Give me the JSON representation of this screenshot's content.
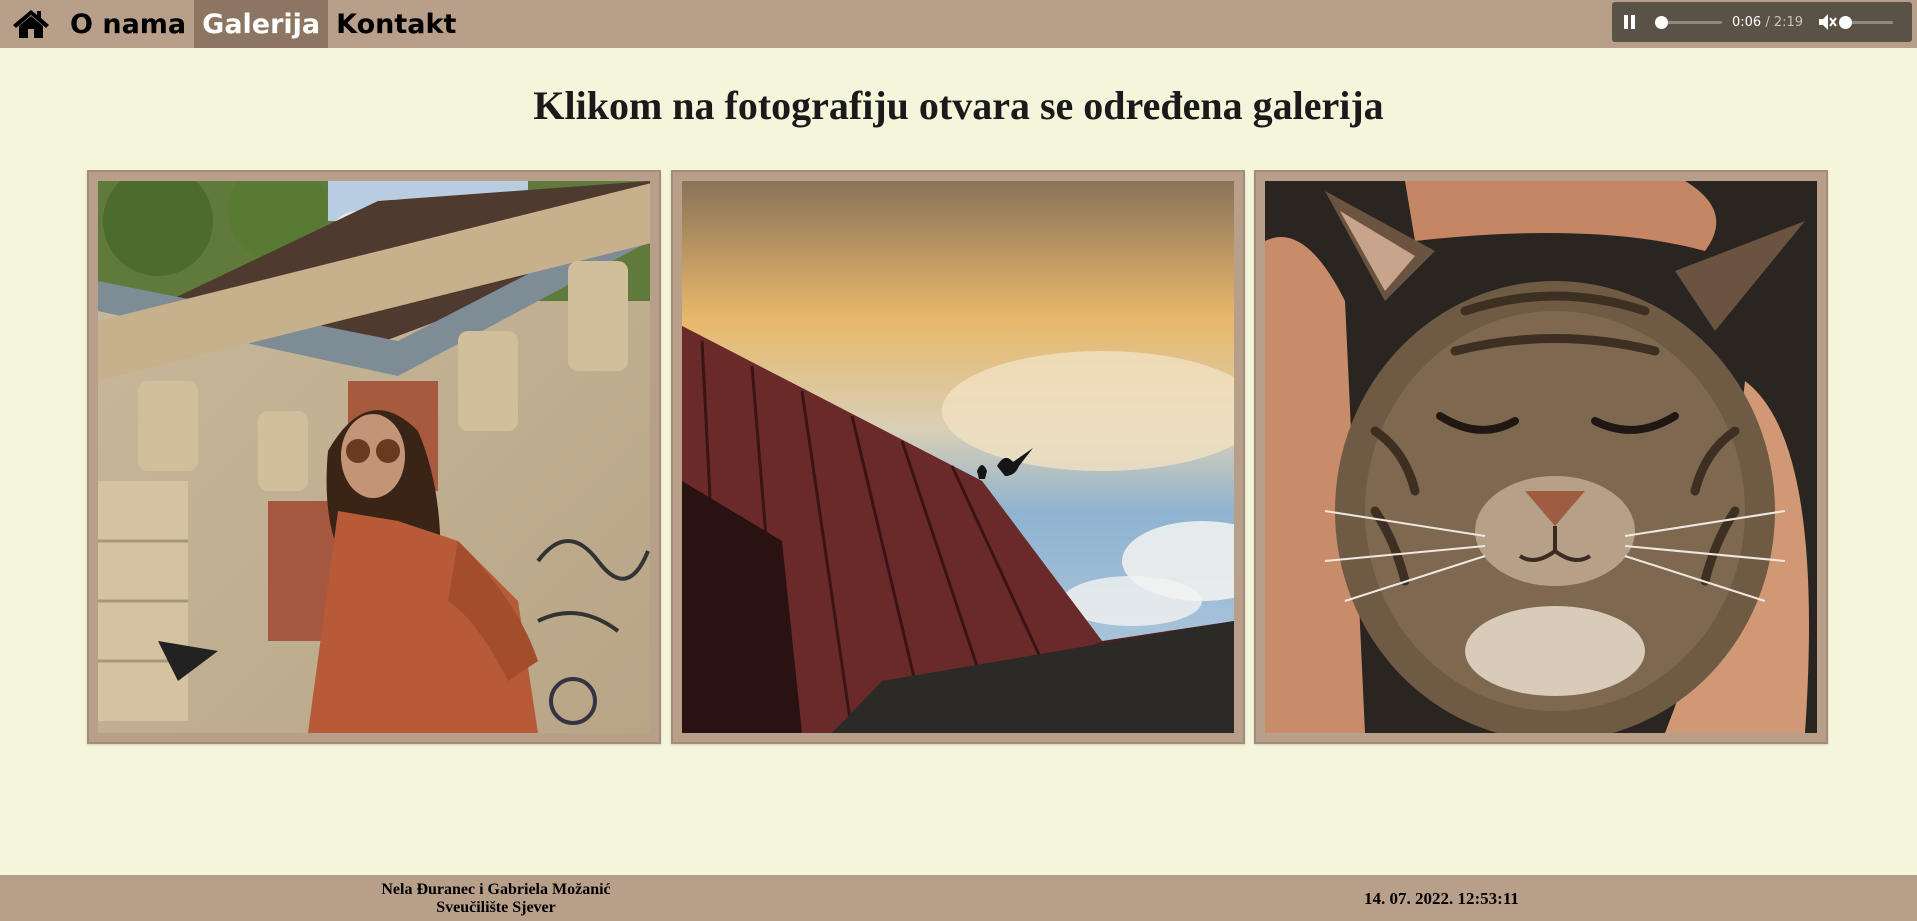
{
  "nav": {
    "home_icon": "home-icon",
    "items": [
      {
        "label": "O nama",
        "active": false
      },
      {
        "label": "Galerija",
        "active": true
      },
      {
        "label": "Kontakt",
        "active": false
      }
    ]
  },
  "audio": {
    "current_time": "0:06",
    "separator": "/",
    "duration": "2:19",
    "progress": 0.043,
    "muted": true,
    "volume": 0.0,
    "play_state_icon": "pause-icon",
    "mute_icon": "speaker-muted-icon"
  },
  "heading": "Klikom na fotografiju otvara se određena galerija",
  "gallery": [
    {
      "subject": "portrait"
    },
    {
      "subject": "sky-roof-birds"
    },
    {
      "subject": "kitten"
    }
  ],
  "footer": {
    "authors": "Nela Đuranec i Gabriela Možanić",
    "institution": "Sveučilište Sjever",
    "datetime": "14. 07. 2022. 12:53:11"
  },
  "colors": {
    "background": "#f5f5dc",
    "nav_bar": "#b89f8a",
    "nav_active": "#8c7561",
    "frame": "#b89f8a"
  }
}
